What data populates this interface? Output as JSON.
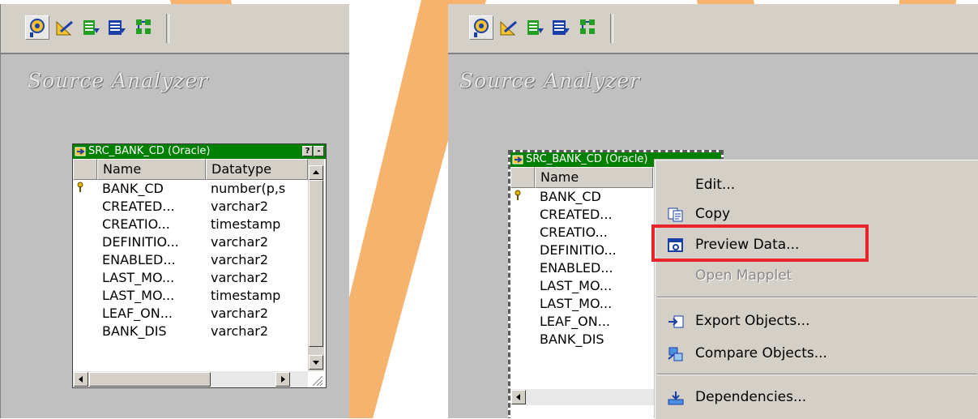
{
  "workspace": {
    "title": "Source Analyzer"
  },
  "source": {
    "title": "SRC_BANK_CD (Oracle)",
    "title_short": "SRC_BANK_CD (Oracle)",
    "columns": {
      "name": "Name",
      "datatype": "Datatype"
    },
    "rows": [
      {
        "name": "BANK_CD",
        "datatype": "number(p,s",
        "key": true
      },
      {
        "name": "CREATED...",
        "datatype": "varchar2"
      },
      {
        "name": "CREATIO...",
        "datatype": "timestamp"
      },
      {
        "name": "DEFINITIO...",
        "datatype": "varchar2"
      },
      {
        "name": "ENABLED...",
        "datatype": "varchar2"
      },
      {
        "name": "LAST_MO...",
        "datatype": "varchar2"
      },
      {
        "name": "LAST_MO...",
        "datatype": "timestamp"
      },
      {
        "name": "LEAF_ON...",
        "datatype": "varchar2"
      },
      {
        "name": "BANK_DIS",
        "datatype": "varchar2"
      }
    ],
    "help_glyph": "?",
    "min_glyph": "-"
  },
  "context_menu": {
    "edit": "Edit...",
    "copy": "Copy",
    "preview": "Preview Data...",
    "open_mapplet": "Open Mapplet",
    "export": "Export Objects...",
    "compare": "Compare Objects...",
    "dependencies": "Dependencies..."
  },
  "toolbar_icons": [
    "source-analyzer-icon",
    "target-designer-icon",
    "transformation-developer-icon",
    "mapplet-designer-icon",
    "mapping-designer-icon"
  ],
  "colors": {
    "accent_arc": "#f6b36e",
    "title_bar": "#008000",
    "highlight_box": "#e8232a",
    "panel": "#c0c0c0"
  }
}
